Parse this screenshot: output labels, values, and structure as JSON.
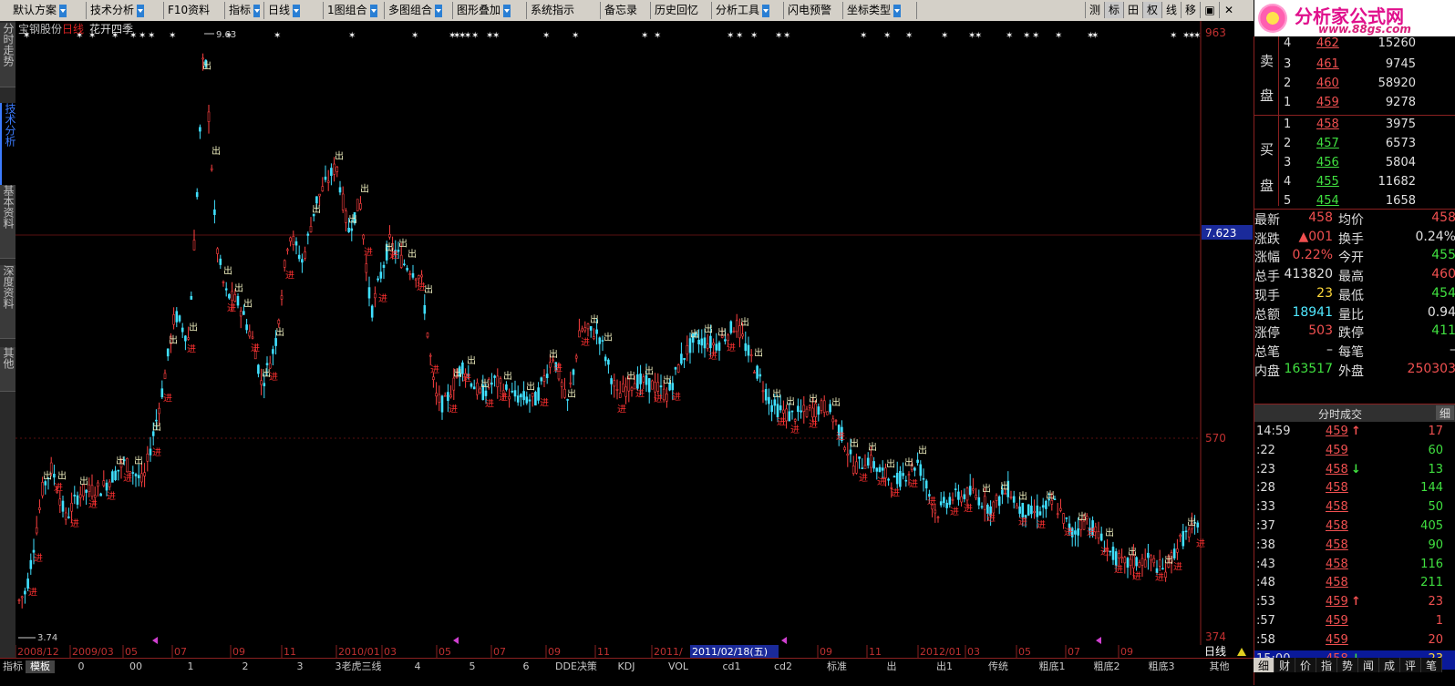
{
  "toolbar": {
    "items": [
      "默认方案",
      "技术分析",
      "F10资料",
      "指标",
      "日线",
      "1图组合",
      "多图组合",
      "图形叠加",
      "系统指示",
      "备忘录",
      "历史回忆",
      "分析工具",
      "闪电预警",
      "坐标类型"
    ],
    "right": [
      "测",
      "标",
      "田",
      "权",
      "线",
      "移",
      "▣",
      "✕"
    ]
  },
  "logo": {
    "title": "分析家公式网",
    "url": "www.88gs.com"
  },
  "left_tabs": [
    "分时走势",
    "技术分析",
    "基本资料",
    "深度资料",
    "其他"
  ],
  "chart": {
    "stock": "宝钢股份",
    "period": "日线",
    "indicator": "花开四季",
    "price_labels": {
      "high": "963",
      "mid_line": "7.623",
      "mid": "570",
      "low": "374"
    },
    "peak_label": "9.63",
    "low_label": "3.74",
    "in_label": "进",
    "out_label": "出",
    "date_labels": [
      "2008/12",
      "2009/03",
      "05",
      "07",
      "09",
      "11",
      "2010/01",
      "03",
      "05",
      "07",
      "09",
      "11",
      "2011/",
      "05",
      "07",
      "09",
      "11",
      "2012/01",
      "03",
      "05",
      "07",
      "09"
    ],
    "cursor_date": "2011/02/18(五)",
    "period_btn": "日线"
  },
  "orderbook": {
    "sell_label": "卖盘",
    "buy_label": "买盘",
    "sells": [
      {
        "lvl": "4",
        "price": "462",
        "vol": "15260"
      },
      {
        "lvl": "3",
        "price": "461",
        "vol": "9745"
      },
      {
        "lvl": "2",
        "price": "460",
        "vol": "58920"
      },
      {
        "lvl": "1",
        "price": "459",
        "vol": "9278"
      }
    ],
    "buys": [
      {
        "lvl": "1",
        "price": "458",
        "vol": "3975"
      },
      {
        "lvl": "2",
        "price": "457",
        "vol": "6573"
      },
      {
        "lvl": "3",
        "price": "456",
        "vol": "5804"
      },
      {
        "lvl": "4",
        "price": "455",
        "vol": "11682"
      },
      {
        "lvl": "5",
        "price": "454",
        "vol": "1658"
      }
    ]
  },
  "quote": [
    {
      "k": "最新",
      "v": "458",
      "vc": "red",
      "k2": "均价",
      "v2": "458",
      "v2c": "red"
    },
    {
      "k": "涨跌",
      "v": "▲001",
      "vc": "red",
      "k2": "换手",
      "v2": "0.24%",
      "v2c": "white"
    },
    {
      "k": "涨幅",
      "v": "0.22%",
      "vc": "red",
      "k2": "今开",
      "v2": "455",
      "v2c": "green"
    },
    {
      "k": "总手",
      "v": "413820",
      "vc": "white",
      "k2": "最高",
      "v2": "460",
      "v2c": "red"
    },
    {
      "k": "现手",
      "v": "23",
      "vc": "yellow",
      "k2": "最低",
      "v2": "454",
      "v2c": "green"
    },
    {
      "k": "总额",
      "v": "18941",
      "vc": "cyan",
      "k2": "量比",
      "v2": "0.94",
      "v2c": "white"
    },
    {
      "k": "涨停",
      "v": "503",
      "vc": "red",
      "k2": "跌停",
      "v2": "411",
      "v2c": "green"
    },
    {
      "k": "总笔",
      "v": "–",
      "vc": "white",
      "k2": "每笔",
      "v2": "–",
      "v2c": "white"
    },
    {
      "k": "内盘",
      "v": "163517",
      "vc": "green",
      "k2": "外盘",
      "v2": "250303",
      "v2c": "red"
    }
  ],
  "ticks_header": {
    "title": "分时成交",
    "btn": "细"
  },
  "ticks": [
    {
      "t": "14:59",
      "p": "459",
      "arrow": "↑",
      "ac": "red",
      "v": "17",
      "vc": "red"
    },
    {
      "t": ":22",
      "p": "459",
      "arrow": "",
      "ac": "",
      "v": "60",
      "vc": "green"
    },
    {
      "t": ":23",
      "p": "458",
      "arrow": "↓",
      "ac": "green",
      "v": "13",
      "vc": "green"
    },
    {
      "t": ":28",
      "p": "458",
      "arrow": "",
      "ac": "",
      "v": "144",
      "vc": "green"
    },
    {
      "t": ":33",
      "p": "458",
      "arrow": "",
      "ac": "",
      "v": "50",
      "vc": "green"
    },
    {
      "t": ":37",
      "p": "458",
      "arrow": "",
      "ac": "",
      "v": "405",
      "vc": "green"
    },
    {
      "t": ":38",
      "p": "458",
      "arrow": "",
      "ac": "",
      "v": "90",
      "vc": "green"
    },
    {
      "t": ":43",
      "p": "458",
      "arrow": "",
      "ac": "",
      "v": "116",
      "vc": "green"
    },
    {
      "t": ":48",
      "p": "458",
      "arrow": "",
      "ac": "",
      "v": "211",
      "vc": "green"
    },
    {
      "t": ":53",
      "p": "459",
      "arrow": "↑",
      "ac": "red",
      "v": "23",
      "vc": "red"
    },
    {
      "t": ":57",
      "p": "459",
      "arrow": "",
      "ac": "",
      "v": "1",
      "vc": "red"
    },
    {
      "t": ":58",
      "p": "459",
      "arrow": "",
      "ac": "",
      "v": "20",
      "vc": "red"
    },
    {
      "t": "15:00",
      "p": "458",
      "arrow": "↓",
      "ac": "green",
      "v": "23",
      "vc": "yellow"
    }
  ],
  "bottom_tabs": [
    "指标",
    "模板",
    "0",
    "00",
    "1",
    "2",
    "3",
    "3老虎三线",
    "4",
    "5",
    "6",
    "DDE决策",
    "KDJ",
    "VOL",
    "cd1",
    "cd2",
    "标准",
    "出",
    "出1",
    "传统",
    "粗底1",
    "粗底2",
    "粗底3",
    "其他"
  ],
  "right_bottom_tabs": [
    "细",
    "财",
    "价",
    "指",
    "势",
    "闻",
    "成",
    "评",
    "笔"
  ]
}
